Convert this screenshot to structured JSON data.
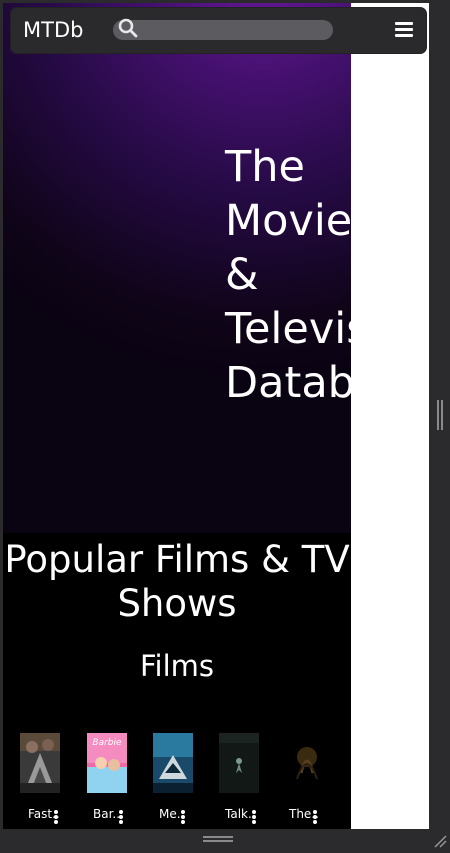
{
  "navbar": {
    "brand": "MTDb",
    "search_placeholder": "",
    "menu_icon": "hamburger-menu-icon"
  },
  "hero": {
    "title_lines": [
      "The",
      "Movie",
      "&",
      "Televis",
      "Datab"
    ]
  },
  "popular": {
    "title": "Popular Films & TV Shows",
    "subtitle": "Films",
    "films": [
      {
        "label": "Fast.."
      },
      {
        "label": "Bar.."
      },
      {
        "label": "Me.."
      },
      {
        "label": "Talk.."
      },
      {
        "label": "The.."
      }
    ]
  },
  "colors": {
    "hero_accent": "#6a1a9c",
    "navbar_bg": "#2a2a2c",
    "page_bg": "#000000"
  }
}
